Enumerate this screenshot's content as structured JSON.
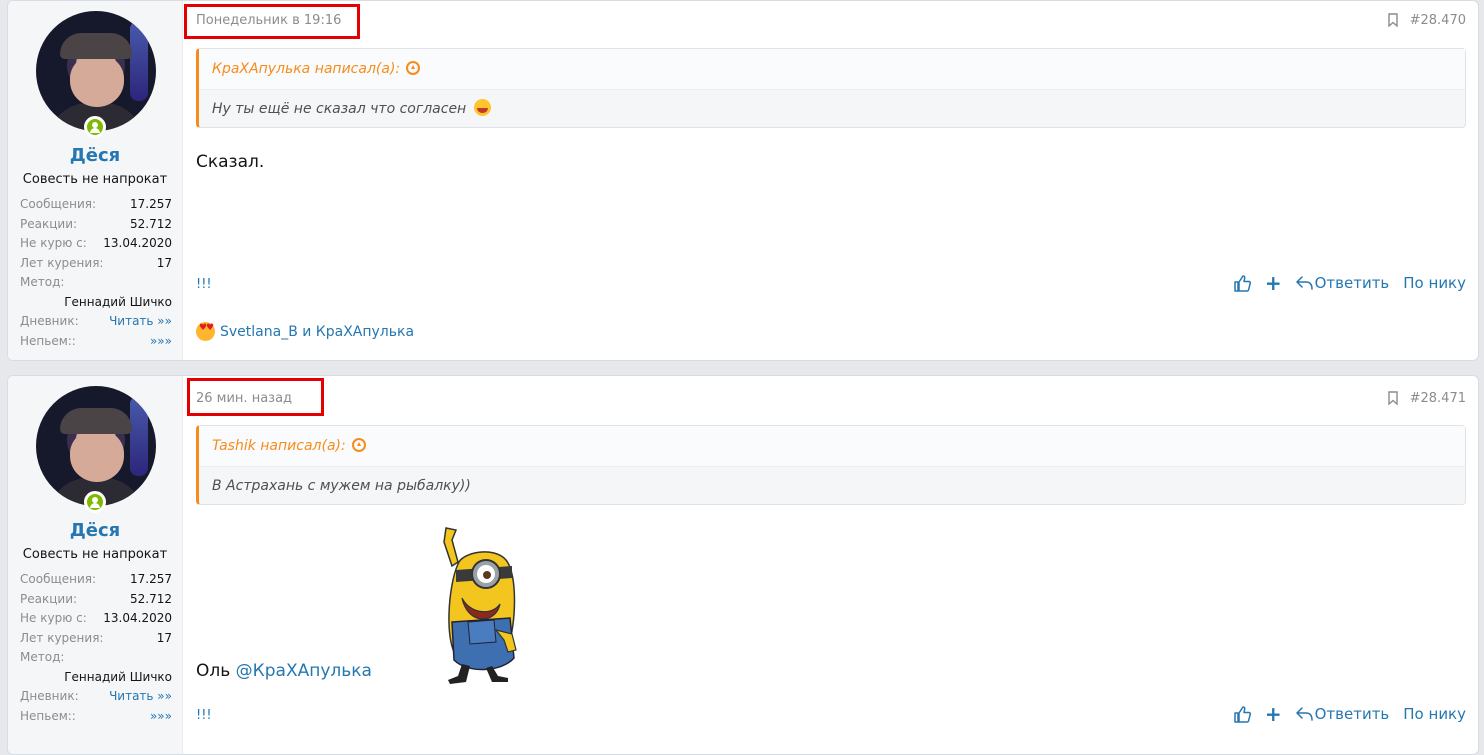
{
  "posts": [
    {
      "user": {
        "name": "Дёся",
        "title": "Совесть не напрокат",
        "stats": [
          {
            "key": "Сообщения:",
            "value": "17.257"
          },
          {
            "key": "Реакции:",
            "value": "52.712"
          },
          {
            "key": "Не курю с:",
            "value": "13.04.2020"
          },
          {
            "key": "Лет курения:",
            "value": "17"
          }
        ],
        "method_key": "Метод:",
        "method_value": "Геннадий Шичко",
        "diary_key": "Дневник:",
        "diary_link": "Читать »»",
        "nekurim_key": "Непьем::",
        "nekurim_link": "»»»"
      },
      "date": "Понедельник в 19:16",
      "number": "#28.470",
      "quote_author": "КраХАпулька написал(а):",
      "quote_text": "Ну ты ещё не сказал что согласен",
      "body": "Сказал.",
      "footer_link": "!!!",
      "reactions": "Svetlana_B и КраХАпулька"
    },
    {
      "user": {
        "name": "Дёся",
        "title": "Совесть не напрокат",
        "stats": [
          {
            "key": "Сообщения:",
            "value": "17.257"
          },
          {
            "key": "Реакции:",
            "value": "52.712"
          },
          {
            "key": "Не курю с:",
            "value": "13.04.2020"
          },
          {
            "key": "Лет курения:",
            "value": "17"
          }
        ],
        "method_key": "Метод:",
        "method_value": "Геннадий Шичко",
        "diary_key": "Дневник:",
        "diary_link": "Читать »»",
        "nekurim_key": "Непьем::",
        "nekurim_link": "»»»"
      },
      "date": "26 мин. назад",
      "number": "#28.471",
      "quote_author": "Tashik написал(а):",
      "quote_text": "В Астрахань с мужем на рыбалку))",
      "body_prefix": "Оль",
      "body_mention": "@КраХАпулька",
      "footer_link": "!!!"
    }
  ],
  "actions": {
    "plus": "+",
    "reply": "Ответить",
    "nick": "По нику"
  },
  "colors": {
    "link": "#2577b1",
    "quote_accent": "#f78c1c",
    "highlight": "#e40000",
    "online": "#7fb900"
  }
}
